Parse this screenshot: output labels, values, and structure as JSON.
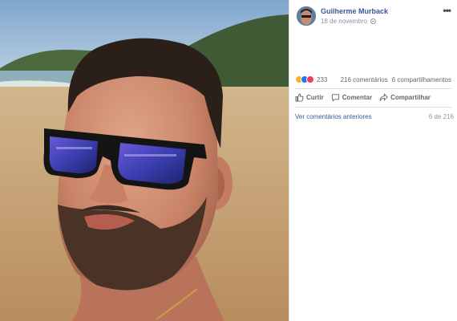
{
  "post": {
    "author": "Guilherme Murback",
    "date": "18 de novembro",
    "privacy_icon": "globe-icon",
    "more_icon": "more-options-icon",
    "more_label": "•••"
  },
  "reactions": {
    "types": [
      "haha",
      "like",
      "love"
    ],
    "count": "233",
    "comments": "216 comentários",
    "shares": "6 compartilhamentos"
  },
  "actions": {
    "like": "Curtir",
    "comment": "Comentar",
    "share": "Compartilhar"
  },
  "comments": {
    "view_previous": "Ver comentários anteriores",
    "pagination": "6 de 216"
  },
  "colors": {
    "link_blue": "#365899",
    "secondary_text": "#90949c",
    "action_text": "#606770",
    "divider": "#dddfe2"
  }
}
